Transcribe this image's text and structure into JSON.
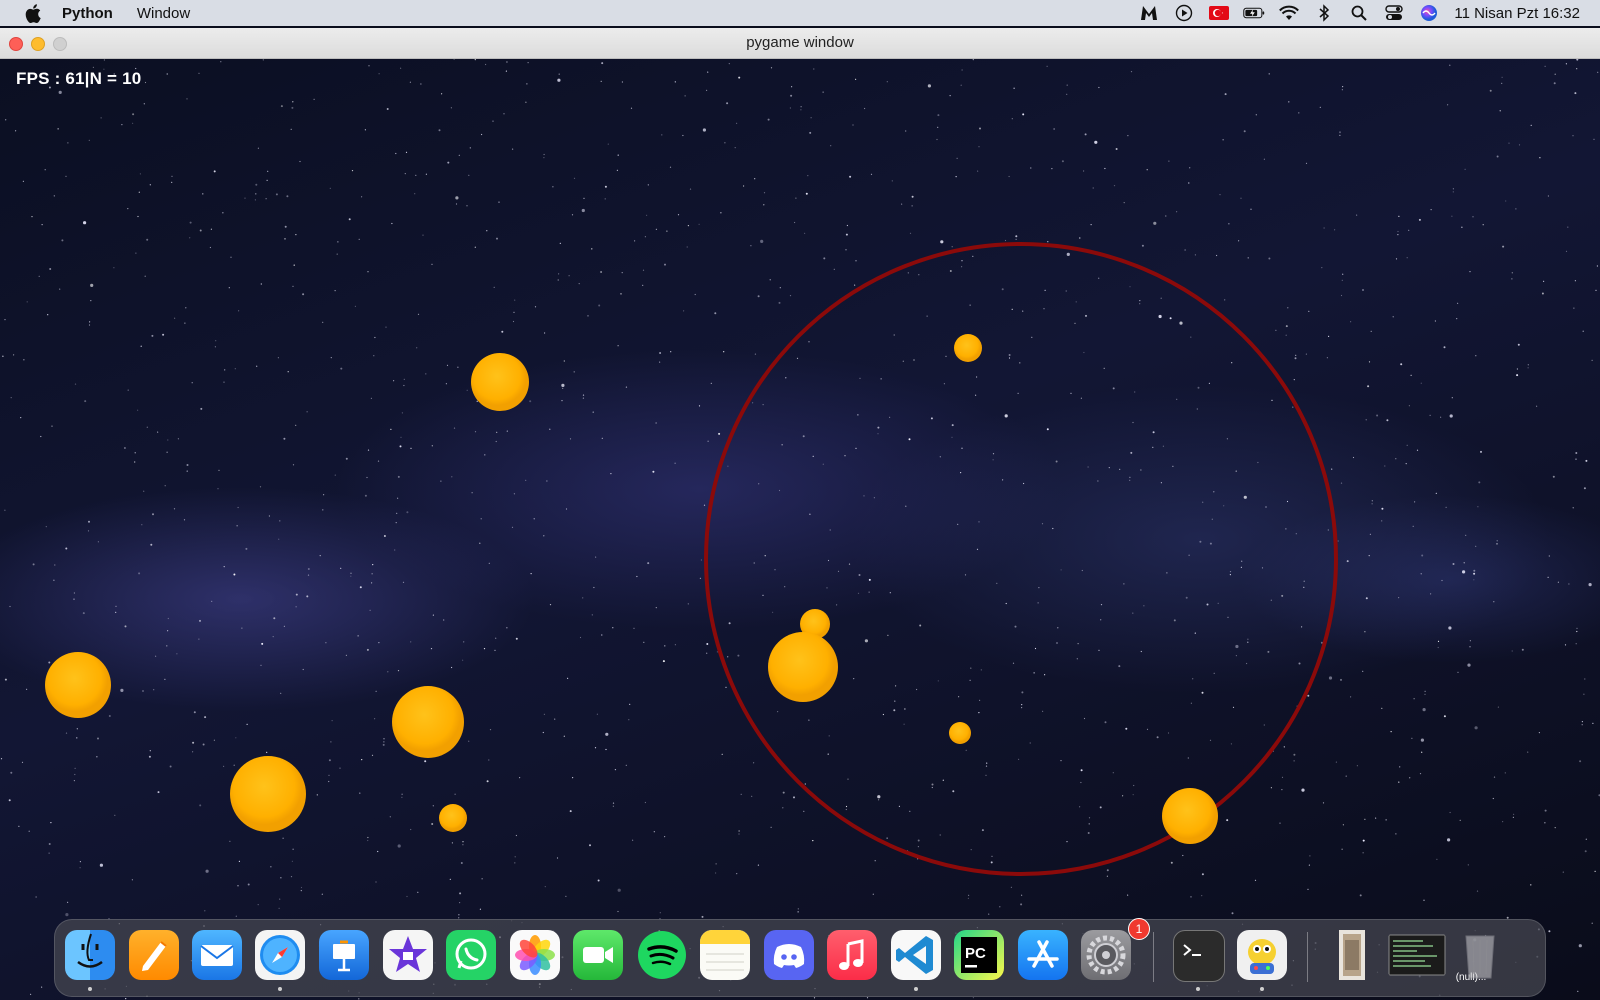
{
  "menubar": {
    "app_name": "Python",
    "menus": [
      "Window"
    ],
    "tray_icons": [
      "malwarebytes-icon",
      "play-icon",
      "turkish-flag-icon",
      "battery-icon",
      "wifi-icon",
      "bluetooth-icon",
      "search-icon",
      "control-center-icon",
      "siri-icon"
    ],
    "clock": "11 Nisan Pzt  16:32"
  },
  "window": {
    "title": "pygame window"
  },
  "game": {
    "hud": "FPS : 61|N = 10",
    "ring_color": "#8b0a0a",
    "ball_color": "#ffb000",
    "balls_count": 10
  },
  "dock": {
    "apps": [
      {
        "name": "finder-icon",
        "running": true
      },
      {
        "name": "pages-icon",
        "running": false
      },
      {
        "name": "mail-icon",
        "running": false
      },
      {
        "name": "safari-icon",
        "running": true
      },
      {
        "name": "keynote-icon",
        "running": false
      },
      {
        "name": "imovie-icon",
        "running": false
      },
      {
        "name": "whatsapp-icon",
        "running": false
      },
      {
        "name": "photos-icon",
        "running": false
      },
      {
        "name": "facetime-icon",
        "running": false
      },
      {
        "name": "spotify-icon",
        "running": false
      },
      {
        "name": "notes-icon",
        "running": false
      },
      {
        "name": "discord-icon",
        "running": false
      },
      {
        "name": "music-icon",
        "running": false
      },
      {
        "name": "vscode-icon",
        "running": true
      },
      {
        "name": "pycharm-icon",
        "running": false
      },
      {
        "name": "app-store-icon",
        "running": false
      },
      {
        "name": "system-preferences-icon",
        "running": false
      },
      {
        "name": "terminal-icon",
        "running": true
      },
      {
        "name": "python-launcher-icon",
        "running": true
      }
    ],
    "app_store_badge": "1",
    "recent_doc_label": "(null)..."
  }
}
